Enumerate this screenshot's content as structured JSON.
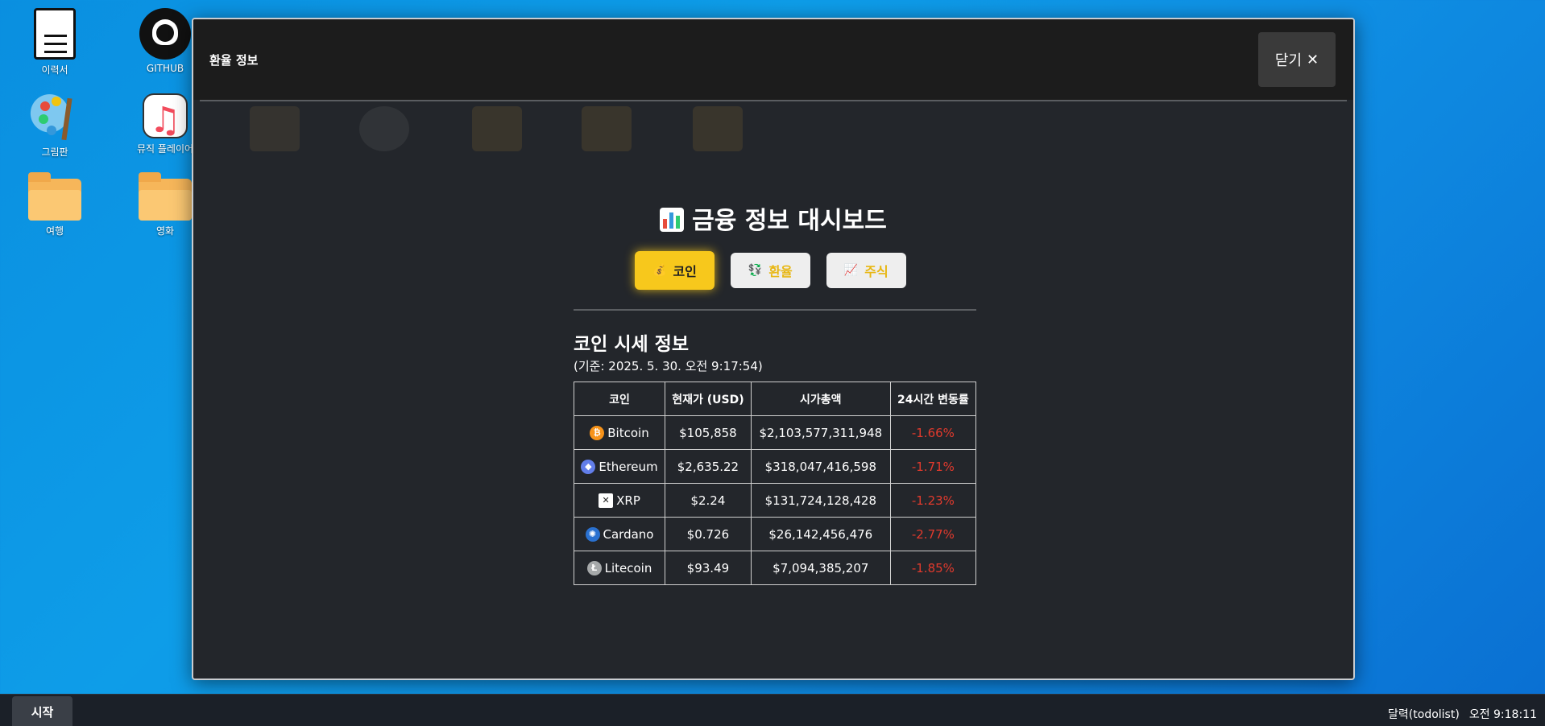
{
  "desktop": {
    "icons": [
      {
        "label": "이력서"
      },
      {
        "label": "GITHUB"
      },
      {
        "label": "그림판"
      },
      {
        "label": "뮤직 플레이어"
      },
      {
        "label": "여행"
      },
      {
        "label": "영화"
      }
    ]
  },
  "window": {
    "title": "환율 정보",
    "close_label": "닫기",
    "close_icon": "✕"
  },
  "dashboard": {
    "title": "금융 정보 대시보드",
    "tabs": [
      {
        "icon": "💰",
        "label": "코인",
        "active": true
      },
      {
        "icon": "💱",
        "label": "환율",
        "active": false
      },
      {
        "icon": "📈",
        "label": "주식",
        "active": false
      }
    ],
    "section_title": "코인 시세 정보",
    "section_sub": "(기준: 2025. 5. 30. 오전 9:17:54)",
    "table": {
      "headers": [
        "코인",
        "현재가 (USD)",
        "시가총액",
        "24시간 변동률"
      ],
      "rows": [
        {
          "name": "Bitcoin",
          "price": "$105,858",
          "cap": "$2,103,577,311,948",
          "change": "-1.66%",
          "icon_color": "#f7931a",
          "icon_glyph": "₿"
        },
        {
          "name": "Ethereum",
          "price": "$2,635.22",
          "cap": "$318,047,416,598",
          "change": "-1.71%",
          "icon_color": "#627eea",
          "icon_glyph": "◆"
        },
        {
          "name": "XRP",
          "price": "$2.24",
          "cap": "$131,724,128,428",
          "change": "-1.23%",
          "icon_color": "#ffffff",
          "icon_glyph": "✕"
        },
        {
          "name": "Cardano",
          "price": "$0.726",
          "cap": "$26,142,456,476",
          "change": "-2.77%",
          "icon_color": "#2a71d0",
          "icon_glyph": "✺"
        },
        {
          "name": "Litecoin",
          "price": "$93.49",
          "cap": "$7,094,385,207",
          "change": "-1.85%",
          "icon_color": "#a6a9aa",
          "icon_glyph": "Ł"
        }
      ]
    }
  },
  "taskbar": {
    "start_label": "시작",
    "tray_app": "달력(todolist)",
    "clock": "오전 9:18:11"
  }
}
